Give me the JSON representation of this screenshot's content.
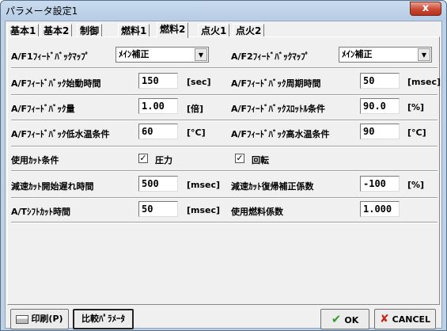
{
  "window": {
    "title": "パラメータ設定1",
    "close_label": "x"
  },
  "tabs": [
    "基本1",
    "基本2",
    "制御",
    "燃料1",
    "燃料2",
    "点火1",
    "点火2"
  ],
  "active_tab": "燃料2",
  "rows": {
    "r1": {
      "left_label": "A/F1ﾌｨｰﾄﾞﾊﾞｯｸﾏｯﾌﾟ",
      "left_value": "ﾒｲﾝ補正",
      "right_label": "A/F2ﾌｨｰﾄﾞﾊﾞｯｸﾏｯﾌﾟ",
      "right_value": "ﾒｲﾝ補正"
    },
    "r2": {
      "left_label": "A/Fﾌｨｰﾄﾞﾊﾞｯｸ始動時間",
      "left_value": "150",
      "left_unit": "[sec]",
      "right_label": "A/Fﾌｨｰﾄﾞﾊﾞｯｸ周期時間",
      "right_value": "50",
      "right_unit": "[msec]"
    },
    "r3": {
      "left_label": "A/Fﾌｨｰﾄﾞﾊﾞｯｸ量",
      "left_value": "1.00",
      "left_unit": "[倍]",
      "right_label": "A/Fﾌｨｰﾄﾞﾊﾞｯｸｽﾛｯﾄﾙ条件",
      "right_value": "90.0",
      "right_unit": "[%]"
    },
    "r4": {
      "left_label": "A/Fﾌｨｰﾄﾞﾊﾞｯｸ低水温条件",
      "left_value": "60",
      "left_unit": "[°C]",
      "right_label": "A/Fﾌｨｰﾄﾞﾊﾞｯｸ高水温条件",
      "right_value": "90",
      "right_unit": "[°C]"
    },
    "r5": {
      "label": "使用ｶｯﾄ条件",
      "check1_label": "圧力",
      "check1_mark": "✓",
      "check2_label": "回転",
      "check2_mark": "✓"
    },
    "r6": {
      "left_label": "減速ｶｯﾄ開始遅れ時間",
      "left_value": "500",
      "left_unit": "[msec]",
      "right_label": "減速ｶｯﾄ復帰補正係数",
      "right_value": "-100",
      "right_unit": "[%]"
    },
    "r7": {
      "left_label": "A/Tｼﾌﾄｶｯﾄ時間",
      "left_value": "50",
      "left_unit": "[msec]",
      "right_label": "使用燃料係数",
      "right_value": "1.000"
    }
  },
  "buttons": {
    "print": "印刷(P)",
    "compare": "比較ﾊﾟﾗﾒｰﾀ",
    "ok": "OK",
    "cancel": "CANCEL",
    "ok_glyph": "✔",
    "cancel_glyph": "✘",
    "combo_arrow": "▼"
  },
  "colors": {
    "title_bar": "#bcd0e6",
    "close_button": "#c94a33",
    "ok_icon": "#3a9c2a",
    "cancel_icon": "#c42a1e"
  }
}
